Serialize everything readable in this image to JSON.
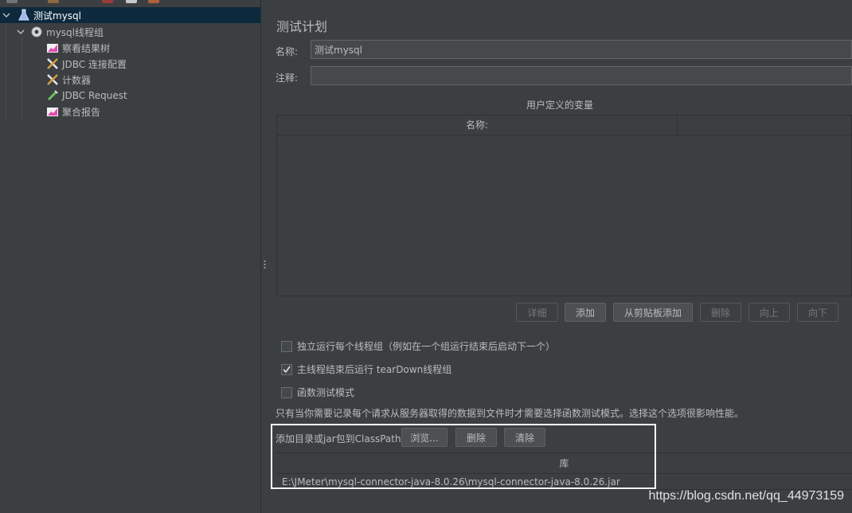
{
  "colors": {
    "background": "#3c3f41",
    "selection": "#0d293e",
    "text": "#bbbbbb"
  },
  "tree": {
    "items": [
      {
        "label": "测试mysql",
        "icon": "test-plan-icon",
        "selected": true
      },
      {
        "label": "mysql线程组",
        "icon": "gear-icon"
      },
      {
        "label": "察看结果树",
        "icon": "listener-graph-icon"
      },
      {
        "label": "JDBC 连接配置",
        "icon": "config-tools-icon"
      },
      {
        "label": "计数器",
        "icon": "config-tools-icon"
      },
      {
        "label": "JDBC Request",
        "icon": "sampler-pipette-icon"
      },
      {
        "label": "聚合报告",
        "icon": "listener-graph-icon"
      }
    ]
  },
  "panel": {
    "title": "测试计划",
    "name_label": "名称:",
    "name_value": "测试mysql",
    "comment_label": "注释:",
    "comment_value": ""
  },
  "variables": {
    "caption": "用户定义的变量",
    "columns": [
      "名称:",
      ""
    ]
  },
  "var_buttons": {
    "detail": "详细",
    "add": "添加",
    "add_from_clipboard": "从剪贴板添加",
    "delete": "删除",
    "up": "向上",
    "down": "向下"
  },
  "options": [
    {
      "label": "独立运行每个线程组（例如在一个组运行结束后启动下一个）",
      "checked": false
    },
    {
      "label": "主线程结束后运行 tearDown线程组",
      "checked": true
    },
    {
      "label": "函数测试模式",
      "checked": false
    }
  ],
  "note": "只有当你需要记录每个请求从服务器取得的数据到文件时才需要选择函数测试模式。选择这个选项很影响性能。",
  "classpath": {
    "label": "添加目录或jar包到ClassPath",
    "browse": "浏览...",
    "delete": "删除",
    "clear": "清除",
    "column": "库",
    "rows": [
      "E:\\JMeter\\mysql-connector-java-8.0.26\\mysql-connector-java-8.0.26.jar"
    ]
  },
  "watermark": "https://blog.csdn.net/qq_44973159"
}
